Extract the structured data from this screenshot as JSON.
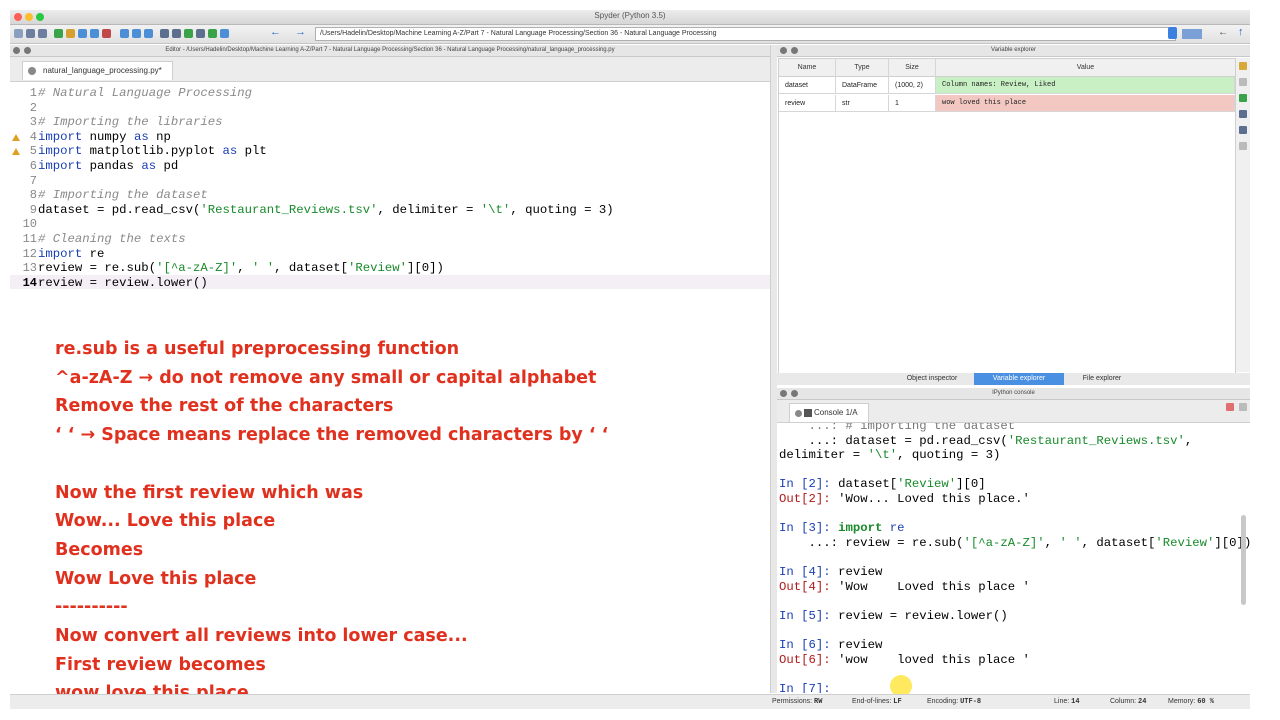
{
  "window": {
    "title": "Spyder (Python 3.5)"
  },
  "toolbar": {
    "path": "/Users/Hadelin/Desktop/Machine Learning A-Z/Part 7 - Natural Language Processing/Section 36 - Natural Language Processing"
  },
  "editor": {
    "header": "Editor - /Users/Hadelin/Desktop/Machine Learning A-Z/Part 7 - Natural Language Processing/Section 36 - Natural Language Processing/natural_language_processing.py",
    "tab": "natural_language_processing.py*",
    "lines": [
      {
        "n": "1",
        "segs": [
          {
            "t": "# Natural Language Processing",
            "c": "cmt"
          }
        ]
      },
      {
        "n": "2",
        "segs": []
      },
      {
        "n": "3",
        "segs": [
          {
            "t": "# Importing the libraries",
            "c": "cmt"
          }
        ]
      },
      {
        "n": "4",
        "warn": true,
        "segs": [
          {
            "t": "import",
            "c": "kw"
          },
          {
            "t": " numpy "
          },
          {
            "t": "as",
            "c": "kw"
          },
          {
            "t": " np"
          }
        ]
      },
      {
        "n": "5",
        "warn": true,
        "segs": [
          {
            "t": "import",
            "c": "kw"
          },
          {
            "t": " matplotlib.pyplot "
          },
          {
            "t": "as",
            "c": "kw"
          },
          {
            "t": " plt"
          }
        ]
      },
      {
        "n": "6",
        "segs": [
          {
            "t": "import",
            "c": "kw"
          },
          {
            "t": " pandas "
          },
          {
            "t": "as",
            "c": "kw"
          },
          {
            "t": " pd"
          }
        ]
      },
      {
        "n": "7",
        "segs": []
      },
      {
        "n": "8",
        "segs": [
          {
            "t": "# Importing the dataset",
            "c": "cmt"
          }
        ]
      },
      {
        "n": "9",
        "segs": [
          {
            "t": "dataset = pd.read_csv("
          },
          {
            "t": "'Restaurant_Reviews.tsv'",
            "c": "str"
          },
          {
            "t": ", delimiter = "
          },
          {
            "t": "'\\t'",
            "c": "str"
          },
          {
            "t": ", quoting = 3)"
          }
        ]
      },
      {
        "n": "10",
        "segs": []
      },
      {
        "n": "11",
        "segs": [
          {
            "t": "# Cleaning the texts",
            "c": "cmt"
          }
        ]
      },
      {
        "n": "12",
        "segs": [
          {
            "t": "import",
            "c": "kw"
          },
          {
            "t": " re"
          }
        ]
      },
      {
        "n": "13",
        "segs": [
          {
            "t": "review = re.sub("
          },
          {
            "t": "'[^a-zA-Z]'",
            "c": "str"
          },
          {
            "t": ", "
          },
          {
            "t": "' '",
            "c": "str"
          },
          {
            "t": ", dataset["
          },
          {
            "t": "'Review'",
            "c": "str"
          },
          {
            "t": "][0])"
          }
        ]
      },
      {
        "n": "14",
        "current": true,
        "segs": [
          {
            "t": "review = review.lower()"
          }
        ]
      }
    ]
  },
  "notes": [
    "re.sub is a useful preprocessing function",
    "^a-zA-Z → do not remove any small or capital alphabet",
    "Remove the rest of the characters",
    "‘ ‘ → Space means  replace the removed characters by ‘ ‘",
    "",
    "Now the first review which was",
    "Wow... Love this place",
    "Becomes",
    "Wow    Love this place",
    "----------",
    "Now convert all reviews into lower case...",
    "First review becomes",
    "wow   love this place"
  ],
  "variable_explorer": {
    "header": "Variable explorer",
    "columns": [
      "Name",
      "Type",
      "Size",
      "Value"
    ],
    "rows": [
      {
        "name": "dataset",
        "type": "DataFrame",
        "size": "(1000, 2)",
        "value": "Column names: Review, Liked",
        "color": "#c9f0c4"
      },
      {
        "name": "review",
        "type": "str",
        "size": "1",
        "value": "wow   loved this place",
        "color": "#f3c8c3"
      }
    ],
    "tabs": [
      "Object inspector",
      "Variable explorer",
      "File explorer"
    ],
    "active_tab": "Variable explorer"
  },
  "console": {
    "header": "IPython console",
    "tab": "Console 1/A",
    "lines": [
      {
        "segs": [
          {
            "t": "    ...: # importing the dataset",
            "c": ""
          }
        ]
      },
      {
        "segs": [
          {
            "t": "    ...: dataset = pd.read_csv("
          },
          {
            "t": "'Restaurant_Reviews.tsv'",
            "c": "str"
          },
          {
            "t": ","
          }
        ]
      },
      {
        "segs": [
          {
            "t": "delimiter = "
          },
          {
            "t": "'\\t'",
            "c": "str"
          },
          {
            "t": ", quoting = 3)"
          }
        ]
      },
      {
        "segs": []
      },
      {
        "segs": [
          {
            "t": "In [",
            "c": "pin"
          },
          {
            "t": "2",
            "c": "pin"
          },
          {
            "t": "]: ",
            "c": "pin"
          },
          {
            "t": "dataset["
          },
          {
            "t": "'Review'",
            "c": "str"
          },
          {
            "t": "][0]"
          }
        ]
      },
      {
        "segs": [
          {
            "t": "Out[",
            "c": "pout"
          },
          {
            "t": "2",
            "c": "pout"
          },
          {
            "t": "]: ",
            "c": "pout"
          },
          {
            "t": "'Wow... Loved this place.'"
          }
        ]
      },
      {
        "segs": []
      },
      {
        "segs": [
          {
            "t": "In [",
            "c": "pin"
          },
          {
            "t": "3",
            "c": "pin"
          },
          {
            "t": "]: ",
            "c": "pin"
          },
          {
            "t": "import",
            "c": "kwg"
          },
          {
            "t": " re",
            "c": "kw"
          }
        ]
      },
      {
        "segs": [
          {
            "t": "    ...: review = re.sub("
          },
          {
            "t": "'[^a-zA-Z]'",
            "c": "str"
          },
          {
            "t": ", "
          },
          {
            "t": "' '",
            "c": "str"
          },
          {
            "t": ", dataset["
          },
          {
            "t": "'Review'",
            "c": "str"
          },
          {
            "t": "][0])"
          }
        ]
      },
      {
        "segs": []
      },
      {
        "segs": [
          {
            "t": "In [",
            "c": "pin"
          },
          {
            "t": "4",
            "c": "pin"
          },
          {
            "t": "]: ",
            "c": "pin"
          },
          {
            "t": "review"
          }
        ]
      },
      {
        "segs": [
          {
            "t": "Out[",
            "c": "pout"
          },
          {
            "t": "4",
            "c": "pout"
          },
          {
            "t": "]: ",
            "c": "pout"
          },
          {
            "t": "'Wow    Loved this place '"
          }
        ]
      },
      {
        "segs": []
      },
      {
        "segs": [
          {
            "t": "In [",
            "c": "pin"
          },
          {
            "t": "5",
            "c": "pin"
          },
          {
            "t": "]: ",
            "c": "pin"
          },
          {
            "t": "review = review.lower()"
          }
        ]
      },
      {
        "segs": []
      },
      {
        "segs": [
          {
            "t": "In [",
            "c": "pin"
          },
          {
            "t": "6",
            "c": "pin"
          },
          {
            "t": "]: ",
            "c": "pin"
          },
          {
            "t": "review"
          }
        ]
      },
      {
        "segs": [
          {
            "t": "Out[",
            "c": "pout"
          },
          {
            "t": "6",
            "c": "pout"
          },
          {
            "t": "]: ",
            "c": "pout"
          },
          {
            "t": "'wow    loved this place '"
          }
        ]
      },
      {
        "segs": []
      },
      {
        "segs": [
          {
            "t": "In [",
            "c": "pin"
          },
          {
            "t": "7",
            "c": "pin"
          },
          {
            "t": "]: ",
            "c": "pin"
          }
        ]
      }
    ]
  },
  "statusbar": {
    "permissions_label": "Permissions:",
    "permissions": "RW",
    "eol_label": "End-of-lines:",
    "eol": "LF",
    "encoding_label": "Encoding:",
    "encoding": "UTF-8",
    "line_label": "Line:",
    "line": "14",
    "column_label": "Column:",
    "column": "24",
    "memory_label": "Memory:",
    "memory": "60 %"
  },
  "colors": {
    "note": "#e0301e",
    "keyword": "#1a3fb5",
    "string": "#178a2a",
    "comment": "#8a8a8a"
  }
}
